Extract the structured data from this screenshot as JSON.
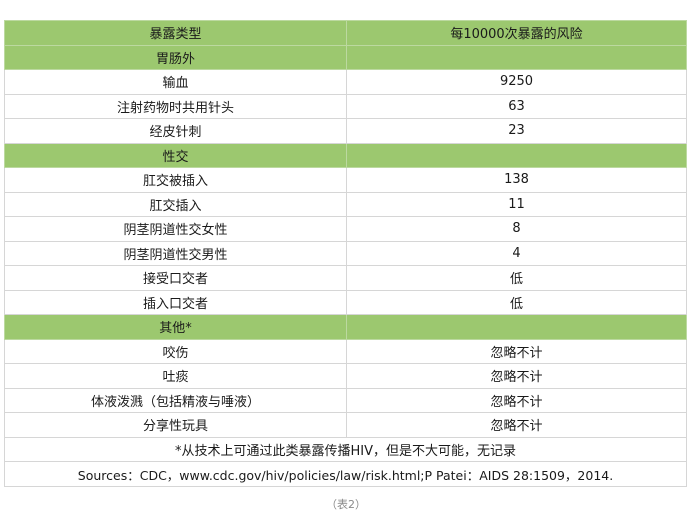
{
  "table": {
    "headers": [
      "暴露类型",
      "每10000次暴露的风险"
    ],
    "sections": [
      {
        "title": "胃肠外",
        "rows": [
          {
            "type": "输血",
            "risk": "9250"
          },
          {
            "type": "注射药物时共用针头",
            "risk": "63"
          },
          {
            "type": "经皮针刺",
            "risk": "23"
          }
        ]
      },
      {
        "title": "性交",
        "rows": [
          {
            "type": "肛交被插入",
            "risk": "138"
          },
          {
            "type": "肛交插入",
            "risk": "11"
          },
          {
            "type": "阴茎阴道性交女性",
            "risk": "8"
          },
          {
            "type": "阴茎阴道性交男性",
            "risk": "4"
          },
          {
            "type": "接受口交者",
            "risk": "低"
          },
          {
            "type": "插入口交者",
            "risk": "低"
          }
        ]
      },
      {
        "title": "其他*",
        "rows": [
          {
            "type": "咬伤",
            "risk": "忽略不计"
          },
          {
            "type": "吐痰",
            "risk": "忽略不计"
          },
          {
            "type": "体液泼溅（包括精液与唾液）",
            "risk": "忽略不计"
          },
          {
            "type": "分享性玩具",
            "risk": "忽略不计"
          }
        ]
      }
    ],
    "footnote": "*从技术上可通过此类暴露传播HIV，但是不大可能，无记录",
    "sources": "Sources：CDC，www.cdc.gov/hiv/policies/law/risk.html;P Patei：AIDS 28:1509，2014."
  },
  "caption": "（表2）"
}
